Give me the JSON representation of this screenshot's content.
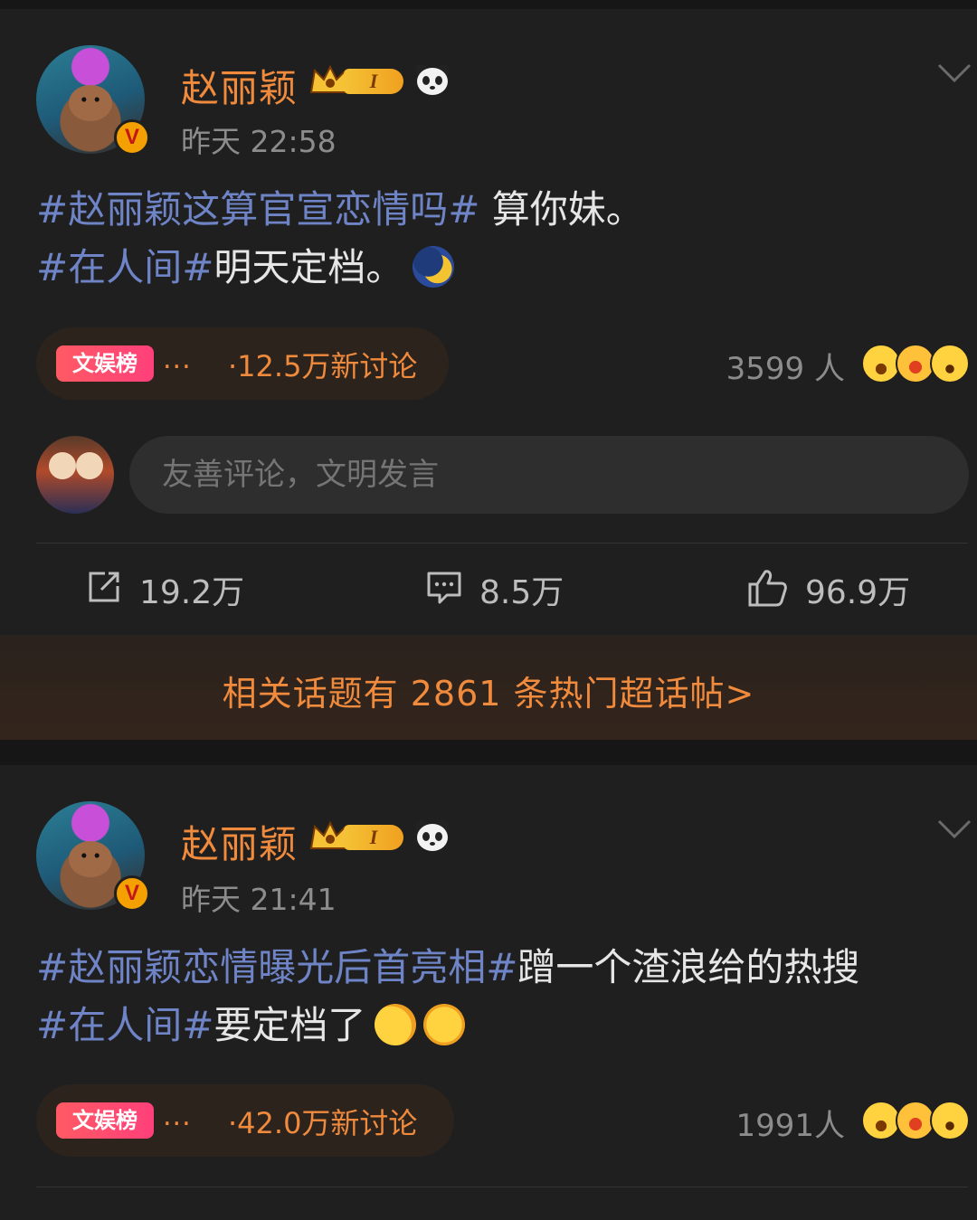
{
  "posts": [
    {
      "username": "赵丽颖",
      "level": "I",
      "time": "昨天 22:58",
      "content_line1_tag": "#赵丽颖这算官宣恋情吗#",
      "content_line1_text": " 算你妹。",
      "content_line2_tag": "#在人间#",
      "content_line2_text": "明天定档。",
      "rank_badge": "文娱榜",
      "rank_dots": "...",
      "rank_text": "·12.5万新讨论",
      "people": "3599 人",
      "comment_placeholder": "友善评论，文明发言",
      "repost": "19.2万",
      "comments": "8.5万",
      "likes": "96.9万"
    },
    {
      "username": "赵丽颖",
      "level": "I",
      "time": "昨天 21:41",
      "content_line1_tag": "#赵丽颖恋情曝光后首亮相#",
      "content_line1_text": "蹭一个渣浪给的热搜",
      "content_line2_tag": "#在人间#",
      "content_line2_text": "要定档了",
      "rank_badge": "文娱榜",
      "rank_dots": "...",
      "rank_text": "·42.0万新讨论",
      "people": "1991人"
    }
  ],
  "topic_banner": "相关话题有 2861 条热门超话帖>",
  "icons": {
    "verified": "v-badge-icon",
    "crown": "crown-icon",
    "panda": "panda-icon",
    "chevron": "chevron-down-icon",
    "repost": "repost-icon",
    "comment": "comment-icon",
    "like": "thumbs-up-icon"
  },
  "colors": {
    "accent": "#f08a3c",
    "hashtag": "#6e84c6",
    "background": "#1f1f1f"
  }
}
